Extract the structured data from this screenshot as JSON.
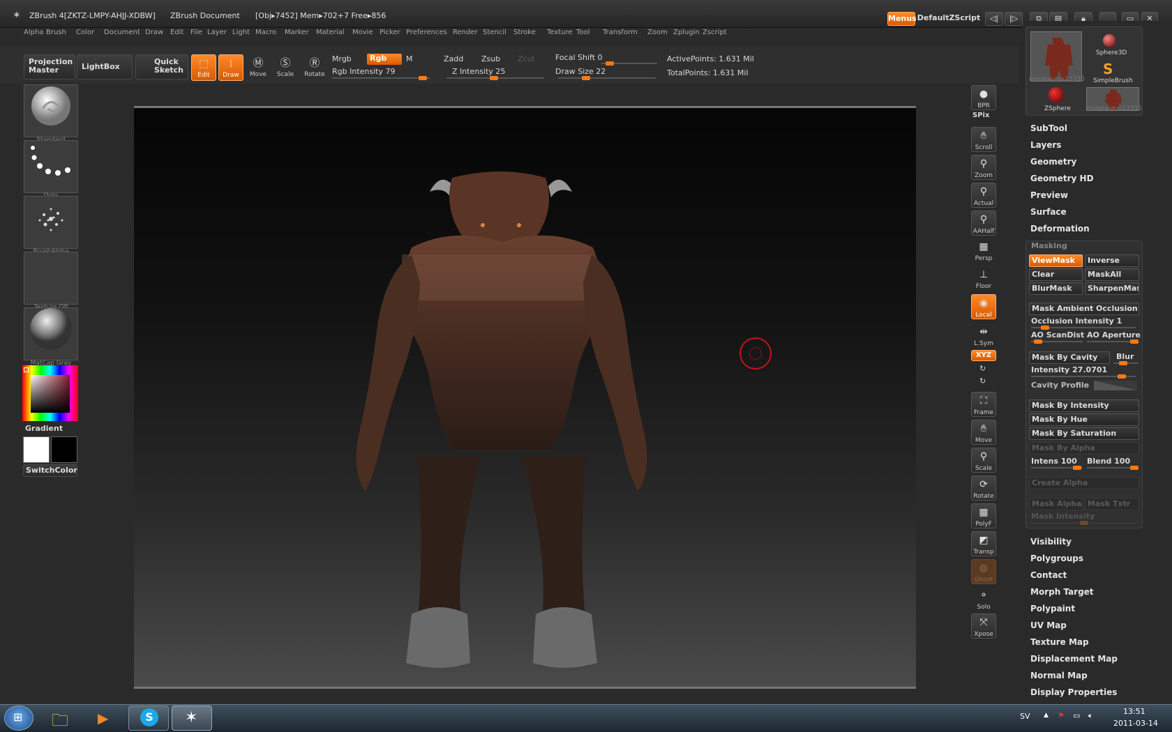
{
  "titlebar": {
    "app": "ZBrush 4[ZKTZ-LMPY-AHJJ-XDBW]",
    "document": "ZBrush Document",
    "stats": "[Obj▸7452] Mem▸702+7 Free▸856",
    "menus_button": "Menus",
    "script_button": "DefaultZScript"
  },
  "menubar": [
    "Alpha",
    "Brush",
    "Color",
    "Document",
    "Draw",
    "Edit",
    "File",
    "Layer",
    "Light",
    "Macro",
    "Marker",
    "Material",
    "Movie",
    "Picker",
    "Preferences",
    "Render",
    "Stencil",
    "Stroke",
    "Texture",
    "Tool",
    "Transform",
    "Zoom",
    "Zplugin",
    "Zscript"
  ],
  "shelf": {
    "projection_master": "Projection Master",
    "lightbox": "LightBox",
    "quick_sketch": "Quick Sketch",
    "edit": "Edit",
    "draw": "Draw",
    "move": "Move",
    "scale": "Scale",
    "rotate": "Rotate",
    "mrgb": "Mrgb",
    "rgb": "Rgb",
    "m": "M",
    "zadd": "Zadd",
    "zsub": "Zsub",
    "zcut": "Zcut",
    "rgb_intensity": "Rgb Intensity 79",
    "z_intensity": "Z Intensity 25",
    "focal_shift": "Focal Shift 0",
    "draw_size": "Draw Size 22",
    "active_points": "ActivePoints: 1.631 Mil",
    "total_points": "TotalPoints: 1.631 Mil"
  },
  "left": {
    "brush": "Standard",
    "stroke": "Dots",
    "alpha": "BrushAlpha",
    "texture": "Texture Off",
    "material": "MatCap Gray",
    "gradient": "Gradient",
    "switch_color": "SwitchColor"
  },
  "right_icons": {
    "bpr": "BPR",
    "spix": "SPix",
    "scroll": "Scroll",
    "zoom": "Zoom",
    "actual": "Actual",
    "aahalf": "AAHalf",
    "persp": "Persp",
    "floor": "Floor",
    "local": "Local",
    "lsym": "L.Sym",
    "xyz": "XYZ",
    "frame": "Frame",
    "move": "Move",
    "scale": "Scale",
    "rotate": "Rotate",
    "polyf": "PolyF",
    "transp": "Transp",
    "ghost": "Ghost",
    "solo": "Solo",
    "xpose": "Xpose"
  },
  "tool_thumbs": [
    "minotaurus23335",
    "Sphere3D",
    "SimpleBrush",
    "ZSphere",
    "minotaurus23335"
  ],
  "palettes_top": [
    "SubTool",
    "Layers",
    "Geometry",
    "Geometry HD",
    "Preview",
    "Surface",
    "Deformation"
  ],
  "masking": {
    "header": "Masking",
    "viewmask": "ViewMask",
    "inverse": "Inverse",
    "clear": "Clear",
    "maskall": "MaskAll",
    "blurmask": "BlurMask",
    "sharpenmask": "SharpenMask",
    "mask_ao": "Mask Ambient Occlusion",
    "occlusion_intensity": "Occlusion Intensity 1",
    "ao_scandist": "AO ScanDist",
    "ao_aperture": "AO Aperture",
    "mask_by_cavity": "Mask By Cavity",
    "blur": "Blur",
    "intensity": "Intensity 27.0701",
    "cavity_profile": "Cavity Profile",
    "mask_by_intensity": "Mask By Intensity",
    "mask_by_hue": "Mask By Hue",
    "mask_by_saturation": "Mask By Saturation",
    "mask_by_alpha": "Mask By Alpha",
    "intens": "Intens 100",
    "blend": "Blend 100",
    "create_alpha": "Create Alpha",
    "mask_alpha": "Mask Alpha",
    "mask_txtr": "Mask Txtr",
    "mask_intensity": "Mask Intensity"
  },
  "palettes_bottom": [
    "Visibility",
    "Polygroups",
    "Contact",
    "Morph Target",
    "Polypaint",
    "UV Map",
    "Texture Map",
    "Displacement Map",
    "Normal Map",
    "Display Properties"
  ],
  "taskbar": {
    "lang": "SV",
    "time": "13:51",
    "date": "2011-03-14"
  },
  "colors": {
    "accent": "#ff7a10",
    "panel": "#2a2a2a"
  }
}
